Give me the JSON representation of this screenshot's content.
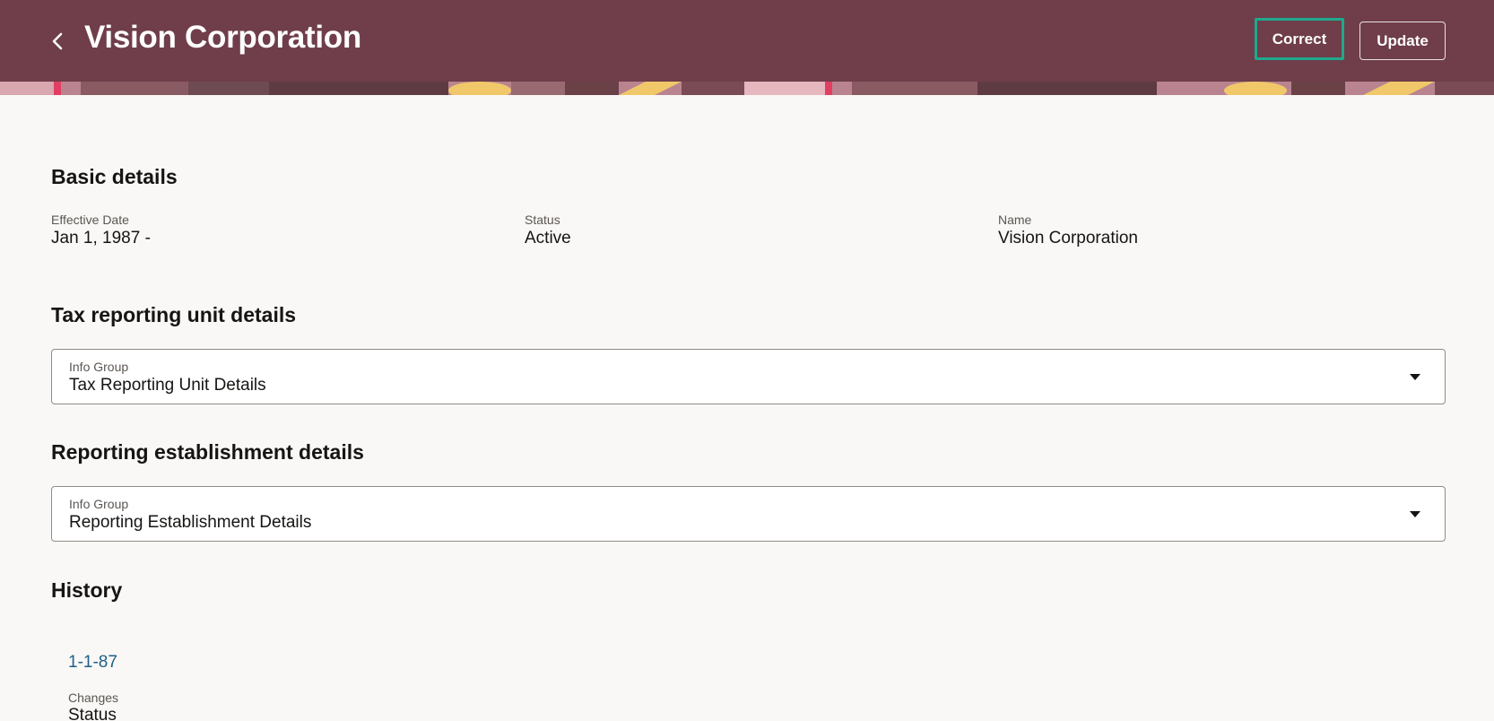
{
  "header": {
    "title": "Vision Corporation",
    "back_icon": "chevron-left-icon",
    "buttons": {
      "correct": "Correct",
      "update": "Update"
    },
    "colors": {
      "header_bg": "#6f3e4a",
      "focus_ring": "#1fa98c"
    }
  },
  "basic_details": {
    "title": "Basic details",
    "fields": [
      {
        "label": "Effective Date",
        "value": "Jan 1, 1987 -"
      },
      {
        "label": "Status",
        "value": "Active"
      },
      {
        "label": "Name",
        "value": "Vision Corporation"
      }
    ]
  },
  "tax_reporting": {
    "title": "Tax reporting unit details",
    "select": {
      "label": "Info Group",
      "value": "Tax Reporting Unit Details"
    }
  },
  "reporting_establishment": {
    "title": "Reporting establishment details",
    "select": {
      "label": "Info Group",
      "value": "Reporting Establishment Details"
    }
  },
  "history": {
    "title": "History",
    "entries": [
      {
        "date": "1-1-87",
        "changes_label": "Changes",
        "change_item": "Status"
      }
    ]
  }
}
